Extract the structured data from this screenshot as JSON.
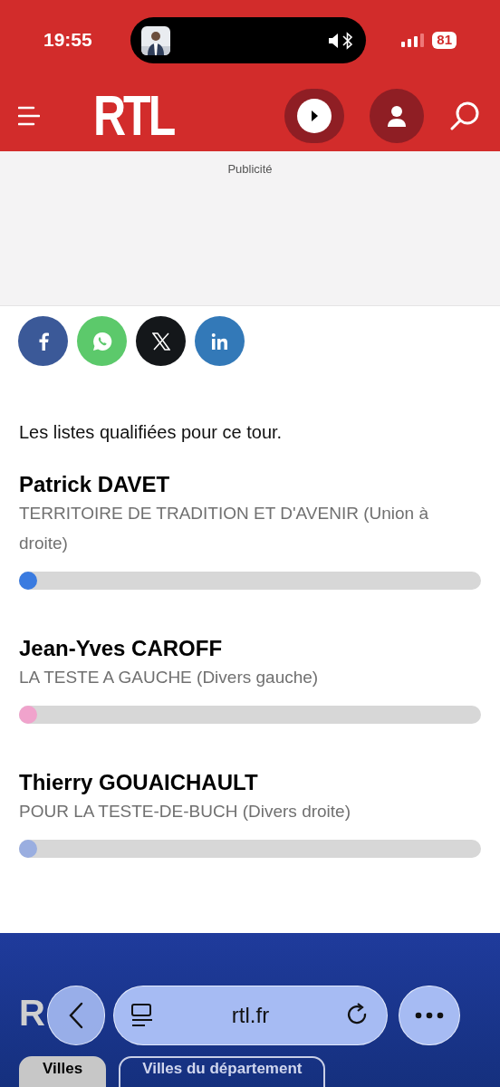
{
  "status_bar": {
    "time": "19:55",
    "battery": "81"
  },
  "header": {
    "logo": "RTL"
  },
  "ad": {
    "label": "Publicité"
  },
  "share": [
    {
      "kind": "facebook"
    },
    {
      "kind": "whatsapp"
    },
    {
      "kind": "x"
    },
    {
      "kind": "linkedin"
    }
  ],
  "intro": "Les listes qualifiées pour ce tour.",
  "candidates": [
    {
      "name": "Patrick DAVET",
      "list": "TERRITOIRE DE TRADITION ET D'AVENIR (Union à droite)",
      "level": 0,
      "color": "#3a7be0"
    },
    {
      "name": "Jean-Yves CAROFF",
      "list": "LA TESTE A GAUCHE (Divers gauche)",
      "level": 0,
      "color": "#f0a3cc"
    },
    {
      "name": "Thierry GOUAICHAULT",
      "list": "POUR LA TESTE-DE-BUCH (Divers droite)",
      "level": 0,
      "color": "#9aaee0"
    }
  ],
  "results": {
    "heading_fragment": "R",
    "tabs": [
      {
        "label": "Villes",
        "selected": true
      },
      {
        "label": "Villes du département",
        "selected": false
      }
    ]
  },
  "browser": {
    "url": "rtl.fr"
  }
}
